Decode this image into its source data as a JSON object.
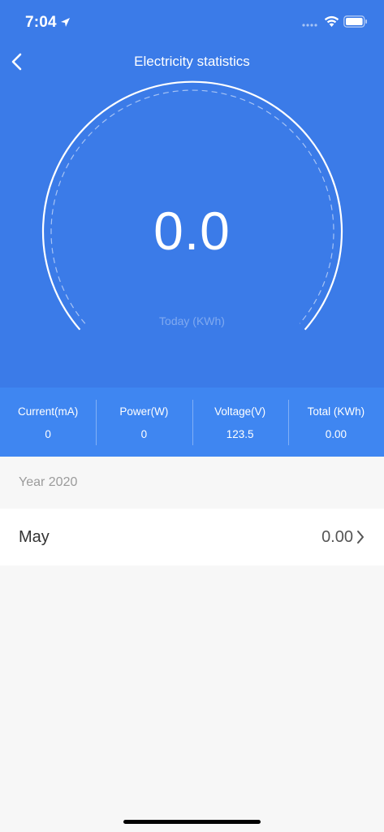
{
  "status_bar": {
    "time": "7:04"
  },
  "nav": {
    "title": "Electricity statistics"
  },
  "gauge": {
    "value": "0.0",
    "label": "Today (KWh)"
  },
  "stats": [
    {
      "label": "Current(mA)",
      "value": "0"
    },
    {
      "label": "Power(W)",
      "value": "0"
    },
    {
      "label": "Voltage(V)",
      "value": "123.5"
    },
    {
      "label": "Total (KWh)",
      "value": "0.00"
    }
  ],
  "history": {
    "year_label": "Year 2020",
    "months": [
      {
        "name": "May",
        "value": "0.00"
      }
    ]
  },
  "colors": {
    "accent": "#3b7be8",
    "stats_bar": "#3f86f1",
    "background": "#f7f7f7"
  }
}
